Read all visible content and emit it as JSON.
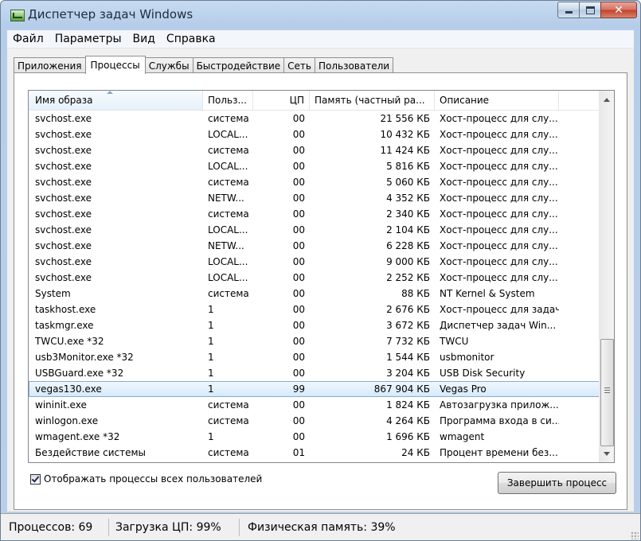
{
  "window": {
    "title": "Диспетчер задач Windows"
  },
  "menu": [
    "Файл",
    "Параметры",
    "Вид",
    "Справка"
  ],
  "tabs": [
    "Приложения",
    "Процессы",
    "Службы",
    "Быстродействие",
    "Сеть",
    "Пользователи"
  ],
  "active_tab": "Процессы",
  "columns": [
    "Имя образа",
    "Польз...",
    "ЦП",
    "Память (частный ра...",
    "Описание"
  ],
  "sorted_column": "Имя образа",
  "processes": [
    {
      "name": "svchost.exe",
      "user": "система",
      "cpu": "00",
      "mem": "21 556 КБ",
      "desc": "Хост-процесс для слу..."
    },
    {
      "name": "svchost.exe",
      "user": "LOCAL...",
      "cpu": "00",
      "mem": "10 432 КБ",
      "desc": "Хост-процесс для слу..."
    },
    {
      "name": "svchost.exe",
      "user": "система",
      "cpu": "00",
      "mem": "11 424 КБ",
      "desc": "Хост-процесс для слу..."
    },
    {
      "name": "svchost.exe",
      "user": "LOCAL...",
      "cpu": "00",
      "mem": "5 816 КБ",
      "desc": "Хост-процесс для слу..."
    },
    {
      "name": "svchost.exe",
      "user": "система",
      "cpu": "00",
      "mem": "5 060 КБ",
      "desc": "Хост-процесс для слу..."
    },
    {
      "name": "svchost.exe",
      "user": "NETW...",
      "cpu": "00",
      "mem": "4 352 КБ",
      "desc": "Хост-процесс для слу..."
    },
    {
      "name": "svchost.exe",
      "user": "система",
      "cpu": "00",
      "mem": "2 340 КБ",
      "desc": "Хост-процесс для слу..."
    },
    {
      "name": "svchost.exe",
      "user": "LOCAL...",
      "cpu": "00",
      "mem": "2 104 КБ",
      "desc": "Хост-процесс для слу..."
    },
    {
      "name": "svchost.exe",
      "user": "NETW...",
      "cpu": "00",
      "mem": "6 228 КБ",
      "desc": "Хост-процесс для слу..."
    },
    {
      "name": "svchost.exe",
      "user": "LOCAL...",
      "cpu": "00",
      "mem": "9 000 КБ",
      "desc": "Хост-процесс для слу..."
    },
    {
      "name": "svchost.exe",
      "user": "LOCAL...",
      "cpu": "00",
      "mem": "2 252 КБ",
      "desc": "Хост-процесс для слу..."
    },
    {
      "name": "System",
      "user": "система",
      "cpu": "00",
      "mem": "88 КБ",
      "desc": "NT Kernel & System"
    },
    {
      "name": "taskhost.exe",
      "user": "1",
      "cpu": "00",
      "mem": "2 676 КБ",
      "desc": "Хост-процесс для задач..."
    },
    {
      "name": "taskmgr.exe",
      "user": "1",
      "cpu": "00",
      "mem": "3 672 КБ",
      "desc": "Диспетчер задач Win..."
    },
    {
      "name": "TWCU.exe *32",
      "user": "1",
      "cpu": "00",
      "mem": "7 732 КБ",
      "desc": "TWCU"
    },
    {
      "name": "usb3Monitor.exe *32",
      "user": "1",
      "cpu": "00",
      "mem": "1 544 КБ",
      "desc": "usbmonitor"
    },
    {
      "name": "USBGuard.exe *32",
      "user": "1",
      "cpu": "00",
      "mem": "3 204 КБ",
      "desc": "USB Disk Security"
    },
    {
      "name": "vegas130.exe",
      "user": "1",
      "cpu": "99",
      "mem": "867 904 КБ",
      "desc": "Vegas Pro"
    },
    {
      "name": "wininit.exe",
      "user": "система",
      "cpu": "00",
      "mem": "1 824 КБ",
      "desc": "Автозагрузка прилож..."
    },
    {
      "name": "winlogon.exe",
      "user": "система",
      "cpu": "00",
      "mem": "4 264 КБ",
      "desc": "Программа входа в си..."
    },
    {
      "name": "wmagent.exe *32",
      "user": "1",
      "cpu": "00",
      "mem": "1 696 КБ",
      "desc": "wmagent"
    },
    {
      "name": "Бездействие системы",
      "user": "система",
      "cpu": "01",
      "mem": "24 КБ",
      "desc": "Процент времени без..."
    }
  ],
  "selected_process": "vegas130.exe",
  "show_all_users": {
    "label": "Отображать процессы всех пользователей",
    "checked": true
  },
  "end_process_button": "Завершить процесс",
  "status": {
    "processes": "Процессов: 69",
    "cpu": "Загрузка ЦП: 99%",
    "memory": "Физическая память: 39%"
  }
}
